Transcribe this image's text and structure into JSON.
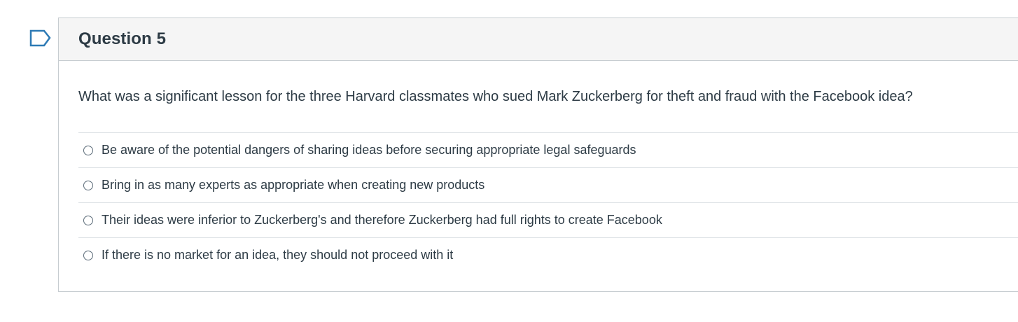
{
  "question": {
    "title": "Question 5",
    "text": "What was a significant lesson for the three Harvard classmates who sued Mark Zuckerberg for theft and fraud with the Facebook idea?",
    "flag_icon": "flag-icon",
    "answers": [
      {
        "label": "Be aware of the potential dangers of sharing ideas before securing appropriate legal safeguards",
        "selected": false
      },
      {
        "label": "Bring in as many experts as appropriate when creating new products",
        "selected": false
      },
      {
        "label": "Their ideas were inferior to Zuckerberg's and therefore Zuckerberg had full rights to create Facebook",
        "selected": false
      },
      {
        "label": "If there is no market for an idea, they should not proceed with it",
        "selected": false
      }
    ]
  },
  "colors": {
    "text": "#2d3b45",
    "header_bg": "#f5f5f5",
    "border": "#c7cdd1",
    "flag": "#2d7ab5"
  }
}
